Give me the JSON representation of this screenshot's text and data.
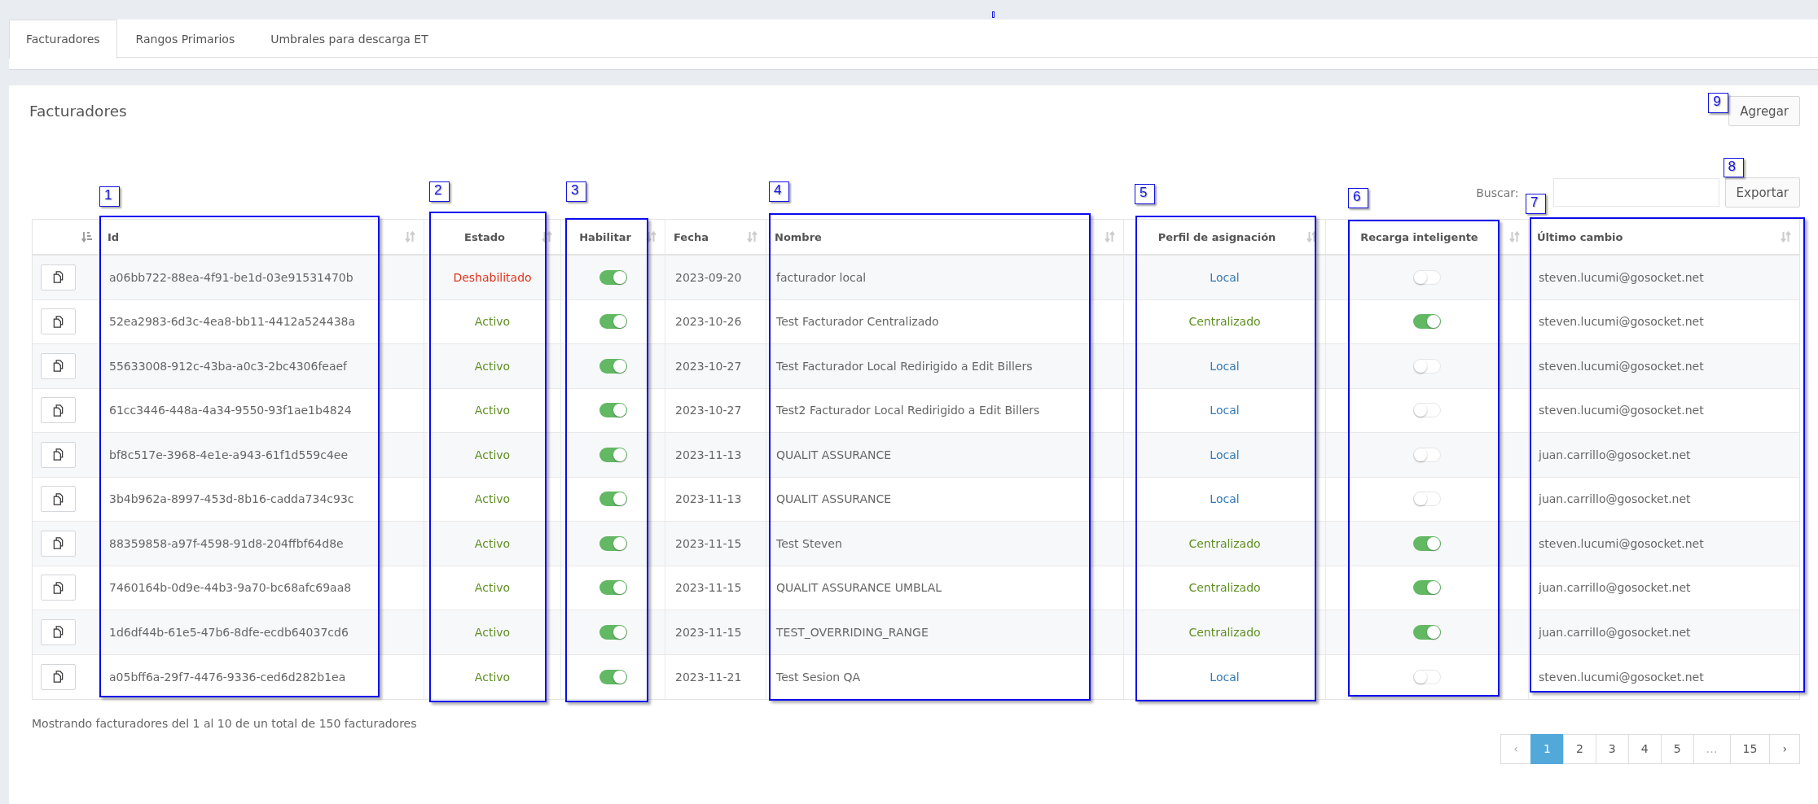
{
  "tabs": [
    {
      "label": "Facturadores",
      "selected": true
    },
    {
      "label": "Rangos Primarios",
      "selected": false
    },
    {
      "label": "Umbrales para descarga ET",
      "selected": false
    }
  ],
  "panel": {
    "title": "Facturadores",
    "add_button": {
      "label": "Agregar",
      "annotation": "9"
    },
    "search": {
      "label": "Buscar:"
    },
    "export_button": {
      "label": "Exportar",
      "annotation": "8"
    }
  },
  "table": {
    "columns": [
      {
        "sorted": true
      },
      {
        "label": "Id",
        "sorted": false,
        "annotation": "1"
      },
      {
        "label": "Estado",
        "sorted": false,
        "annotation": "2"
      },
      {
        "label": "Habilitar",
        "sorted": false,
        "annotation": "3"
      },
      {
        "label": "Fecha",
        "sorted": false
      },
      {
        "label": "Nombre",
        "sorted": false,
        "annotation": "4"
      },
      {
        "label": "Perfil de asignación",
        "sorted": false,
        "annotation": "5"
      },
      {
        "label": "Recarga inteligente",
        "sorted": false,
        "annotation": "6"
      },
      {
        "label": "Último cambio",
        "sorted": false,
        "annotation": "7"
      }
    ],
    "rows": [
      {
        "id": "a06bb722-88ea-4f91-be1d-03e91531470b",
        "status": {
          "text": "Deshabilitado",
          "color": "#e2331b"
        },
        "enabled": true,
        "date": "2023-09-20",
        "name": "facturador local",
        "profile": {
          "text": "Local",
          "color": "#337ab7"
        },
        "smart_recharge": false,
        "last_change": "steven.lucumi@gosocket.net"
      },
      {
        "id": "52ea2983-6d3c-4ea8-bb11-4412a524438a",
        "status": {
          "text": "Activo",
          "color": "#5f8f22"
        },
        "enabled": true,
        "date": "2023-10-26",
        "name": "Test Facturador Centralizado",
        "profile": {
          "text": "Centralizado",
          "color": "#5f8f22"
        },
        "smart_recharge": true,
        "last_change": "steven.lucumi@gosocket.net"
      },
      {
        "id": "55633008-912c-43ba-a0c3-2bc4306feaef",
        "status": {
          "text": "Activo",
          "color": "#5f8f22"
        },
        "enabled": true,
        "date": "2023-10-27",
        "name": "Test Facturador Local Redirigido a Edit Billers",
        "profile": {
          "text": "Local",
          "color": "#337ab7"
        },
        "smart_recharge": false,
        "last_change": "steven.lucumi@gosocket.net"
      },
      {
        "id": "61cc3446-448a-4a34-9550-93f1ae1b4824",
        "status": {
          "text": "Activo",
          "color": "#5f8f22"
        },
        "enabled": true,
        "date": "2023-10-27",
        "name": "Test2 Facturador Local Redirigido a Edit Billers",
        "profile": {
          "text": "Local",
          "color": "#337ab7"
        },
        "smart_recharge": false,
        "last_change": "steven.lucumi@gosocket.net"
      },
      {
        "id": "bf8c517e-3968-4e1e-a943-61f1d559c4ee",
        "status": {
          "text": "Activo",
          "color": "#5f8f22"
        },
        "enabled": true,
        "date": "2023-11-13",
        "name": "QUALIT ASSURANCE",
        "profile": {
          "text": "Local",
          "color": "#337ab7"
        },
        "smart_recharge": false,
        "last_change": "juan.carrillo@gosocket.net"
      },
      {
        "id": "3b4b962a-8997-453d-8b16-cadda734c93c",
        "status": {
          "text": "Activo",
          "color": "#5f8f22"
        },
        "enabled": true,
        "date": "2023-11-13",
        "name": "QUALIT ASSURANCE",
        "profile": {
          "text": "Local",
          "color": "#337ab7"
        },
        "smart_recharge": false,
        "last_change": "juan.carrillo@gosocket.net"
      },
      {
        "id": "88359858-a97f-4598-91d8-204ffbf64d8e",
        "status": {
          "text": "Activo",
          "color": "#5f8f22"
        },
        "enabled": true,
        "date": "2023-11-15",
        "name": "Test Steven",
        "profile": {
          "text": "Centralizado",
          "color": "#5f8f22"
        },
        "smart_recharge": true,
        "last_change": "steven.lucumi@gosocket.net"
      },
      {
        "id": "7460164b-0d9e-44b3-9a70-bc68afc69aa8",
        "status": {
          "text": "Activo",
          "color": "#5f8f22"
        },
        "enabled": true,
        "date": "2023-11-15",
        "name": "QUALIT ASSURANCE UMBLAL",
        "profile": {
          "text": "Centralizado",
          "color": "#5f8f22"
        },
        "smart_recharge": true,
        "last_change": "juan.carrillo@gosocket.net"
      },
      {
        "id": "1d6df44b-61e5-47b6-8dfe-ecdb64037cd6",
        "status": {
          "text": "Activo",
          "color": "#5f8f22"
        },
        "enabled": true,
        "date": "2023-11-15",
        "name": "TEST_OVERRIDING_RANGE",
        "profile": {
          "text": "Centralizado",
          "color": "#5f8f22"
        },
        "smart_recharge": true,
        "last_change": "juan.carrillo@gosocket.net"
      },
      {
        "id": "a05bff6a-29f7-4476-9336-ced6d282b1ea",
        "status": {
          "text": "Activo",
          "color": "#5f8f22"
        },
        "enabled": true,
        "date": "2023-11-21",
        "name": "Test Sesion QA",
        "profile": {
          "text": "Local",
          "color": "#337ab7"
        },
        "smart_recharge": false,
        "last_change": "steven.lucumi@gosocket.net"
      }
    ]
  },
  "info": "Mostrando facturadores del 1 al 10 de un total de 150 facturadores",
  "pagination": {
    "pages": [
      {
        "label": "‹",
        "selected": false,
        "disabled": true
      },
      {
        "label": "1",
        "selected": true,
        "disabled": false
      },
      {
        "label": "2",
        "selected": false,
        "disabled": false
      },
      {
        "label": "3",
        "selected": false,
        "disabled": false
      },
      {
        "label": "4",
        "selected": false,
        "disabled": false
      },
      {
        "label": "5",
        "selected": false,
        "disabled": false
      },
      {
        "label": "…",
        "selected": false,
        "disabled": true
      },
      {
        "label": "15",
        "selected": false,
        "disabled": false
      },
      {
        "label": "›",
        "selected": false,
        "disabled": false
      }
    ]
  }
}
